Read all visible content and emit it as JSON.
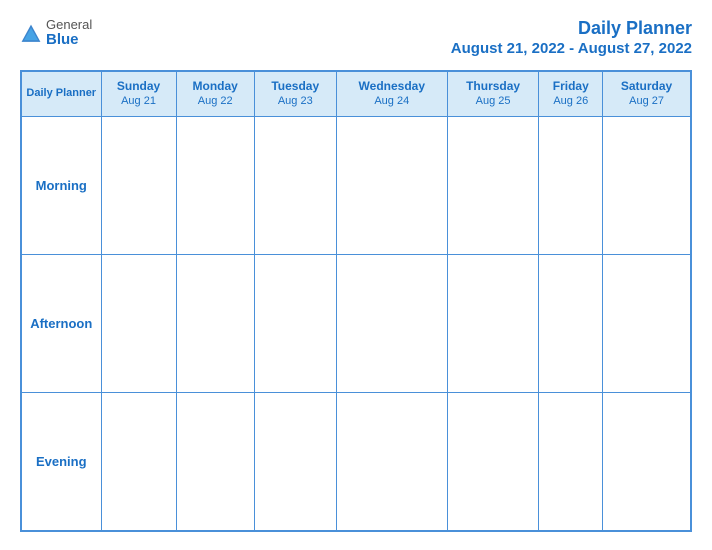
{
  "logo": {
    "general": "General",
    "blue": "Blue"
  },
  "header": {
    "title": "Daily Planner",
    "date_range": "August 21, 2022 - August 27, 2022"
  },
  "table": {
    "planner_label": "Daily Planner",
    "columns": [
      {
        "day": "Sunday",
        "date": "Aug 21"
      },
      {
        "day": "Monday",
        "date": "Aug 22"
      },
      {
        "day": "Tuesday",
        "date": "Aug 23"
      },
      {
        "day": "Wednesday",
        "date": "Aug 24"
      },
      {
        "day": "Thursday",
        "date": "Aug 25"
      },
      {
        "day": "Friday",
        "date": "Aug 26"
      },
      {
        "day": "Saturday",
        "date": "Aug 27"
      }
    ],
    "rows": [
      {
        "label": "Morning"
      },
      {
        "label": "Afternoon"
      },
      {
        "label": "Evening"
      }
    ]
  }
}
